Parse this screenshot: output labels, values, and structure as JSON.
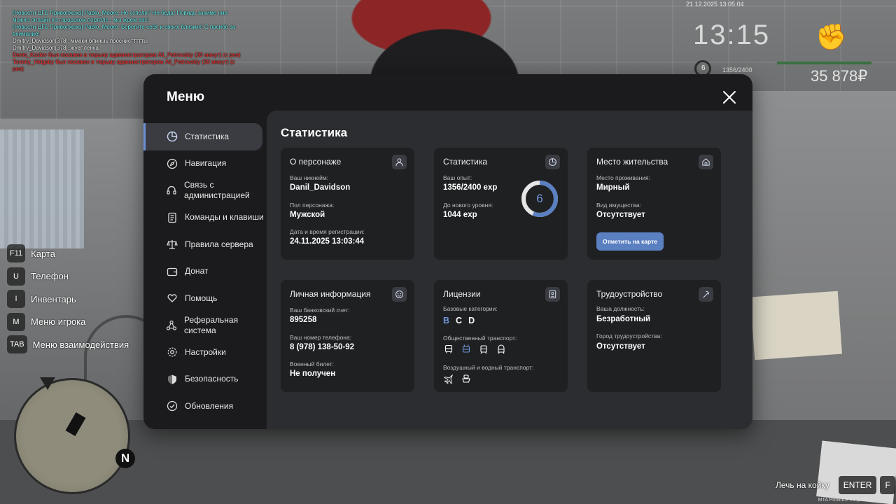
{
  "chat": [
    {
      "color": "cyan",
      "text": "[Новости ЦГБ Приволжска] Pablo_Moore: Не успели? Не беда! Повидь заниме ние можно онлайн на городском портале - мы ждем вас!"
    },
    {
      "color": "cyan",
      "text": "[Новости ЦГБ Приволжска] Pablo_Moore: Берегите себя и своих близких! С пасибо за внимание!"
    },
    {
      "color": "white",
      "text": "Dmitry_Davidson[378]: ммаки блиныь проснисттттты"
    },
    {
      "color": "white",
      "text": "Dmitry_Davidson[378]: жуепленка"
    },
    {
      "color": "red",
      "text": "Denis_Kozlov был посажен в тюрьму администратором Ali_Petrovskiy (30 минут) (с рея)"
    },
    {
      "color": "red",
      "text": "Tommy_Hidgsby был посажен в тюрьму администратором Ali_Petrovskiy (30 минут) (с рея)"
    }
  ],
  "hud": {
    "date": "21.12.2025 13:05:04",
    "time": "13:15",
    "level": "6",
    "exp": "1356/2400",
    "money": "35 878₽"
  },
  "keys": [
    {
      "key": "F11",
      "label": "Карта"
    },
    {
      "key": "U",
      "label": "Телефон"
    },
    {
      "key": "I",
      "label": "Инвентарь"
    },
    {
      "key": "M",
      "label": "Меню игрока"
    },
    {
      "key": "TAB",
      "label": "Меню взаимодействия"
    }
  ],
  "prompt": {
    "text": "Лечь на койку",
    "key1": "ENTER",
    "key2": "F"
  },
  "build": "MTA Province #4 (build 6.12421.5)",
  "minimap": {
    "north": "N"
  },
  "menu": {
    "title": "Меню",
    "nav": [
      {
        "label": "Статистика",
        "icon": "pie-chart-icon"
      },
      {
        "label": "Навигация",
        "icon": "compass-icon"
      },
      {
        "label": "Связь с администрацией",
        "icon": "headset-icon"
      },
      {
        "label": "Команды и клавиши",
        "icon": "document-icon"
      },
      {
        "label": "Правила сервера",
        "icon": "scales-icon"
      },
      {
        "label": "Донат",
        "icon": "wallet-icon"
      },
      {
        "label": "Помощь",
        "icon": "heart-hand-icon"
      },
      {
        "label": "Реферальная система",
        "icon": "network-icon"
      },
      {
        "label": "Настройки",
        "icon": "gear-icon"
      },
      {
        "label": "Безопасность",
        "icon": "shield-icon"
      },
      {
        "label": "Обновления",
        "icon": "check-circle-icon"
      }
    ],
    "content_title": "Статистика",
    "character": {
      "title": "О персонаже",
      "nick_label": "Ваш никнейм:",
      "nick": "Danil_Davidson",
      "gender_label": "Пол персонажа:",
      "gender": "Мужской",
      "reg_label": "Дата и время регистрации:",
      "reg": "24.11.2025 13:03:44"
    },
    "stats": {
      "title": "Статистика",
      "exp_label": "Ваш опыт:",
      "exp": "1356/2400 exp",
      "next_label": "До нового уровня:",
      "next": "1044 exp",
      "level": "6",
      "progress": 0.565
    },
    "residence": {
      "title": "Место жительства",
      "place_label": "Место проживания:",
      "place": "Мирный",
      "property_label": "Вид имущества:",
      "property": "Отсутствует",
      "button": "Отметить на карте"
    },
    "personal": {
      "title": "Личная информация",
      "bank_label": "Ваш банковский счет:",
      "bank": "895258",
      "phone_label": "Ваш номер телефона:",
      "phone": "8 (978) 138-50-92",
      "military_label": "Военный билет:",
      "military": "Не получен"
    },
    "licenses": {
      "title": "Лицензии",
      "base_label": "Базовые категории:",
      "categories": [
        {
          "name": "B",
          "active": true
        },
        {
          "name": "C",
          "active": false
        },
        {
          "name": "D",
          "active": false
        }
      ],
      "public_label": "Общественный транспорт:",
      "air_label": "Воздушный и водный транспорт:"
    },
    "employment": {
      "title": "Трудоустройство",
      "position_label": "Ваша должность:",
      "position": "Безработный",
      "city_label": "Город трудоустройства:",
      "city": "Отсутствует"
    }
  }
}
